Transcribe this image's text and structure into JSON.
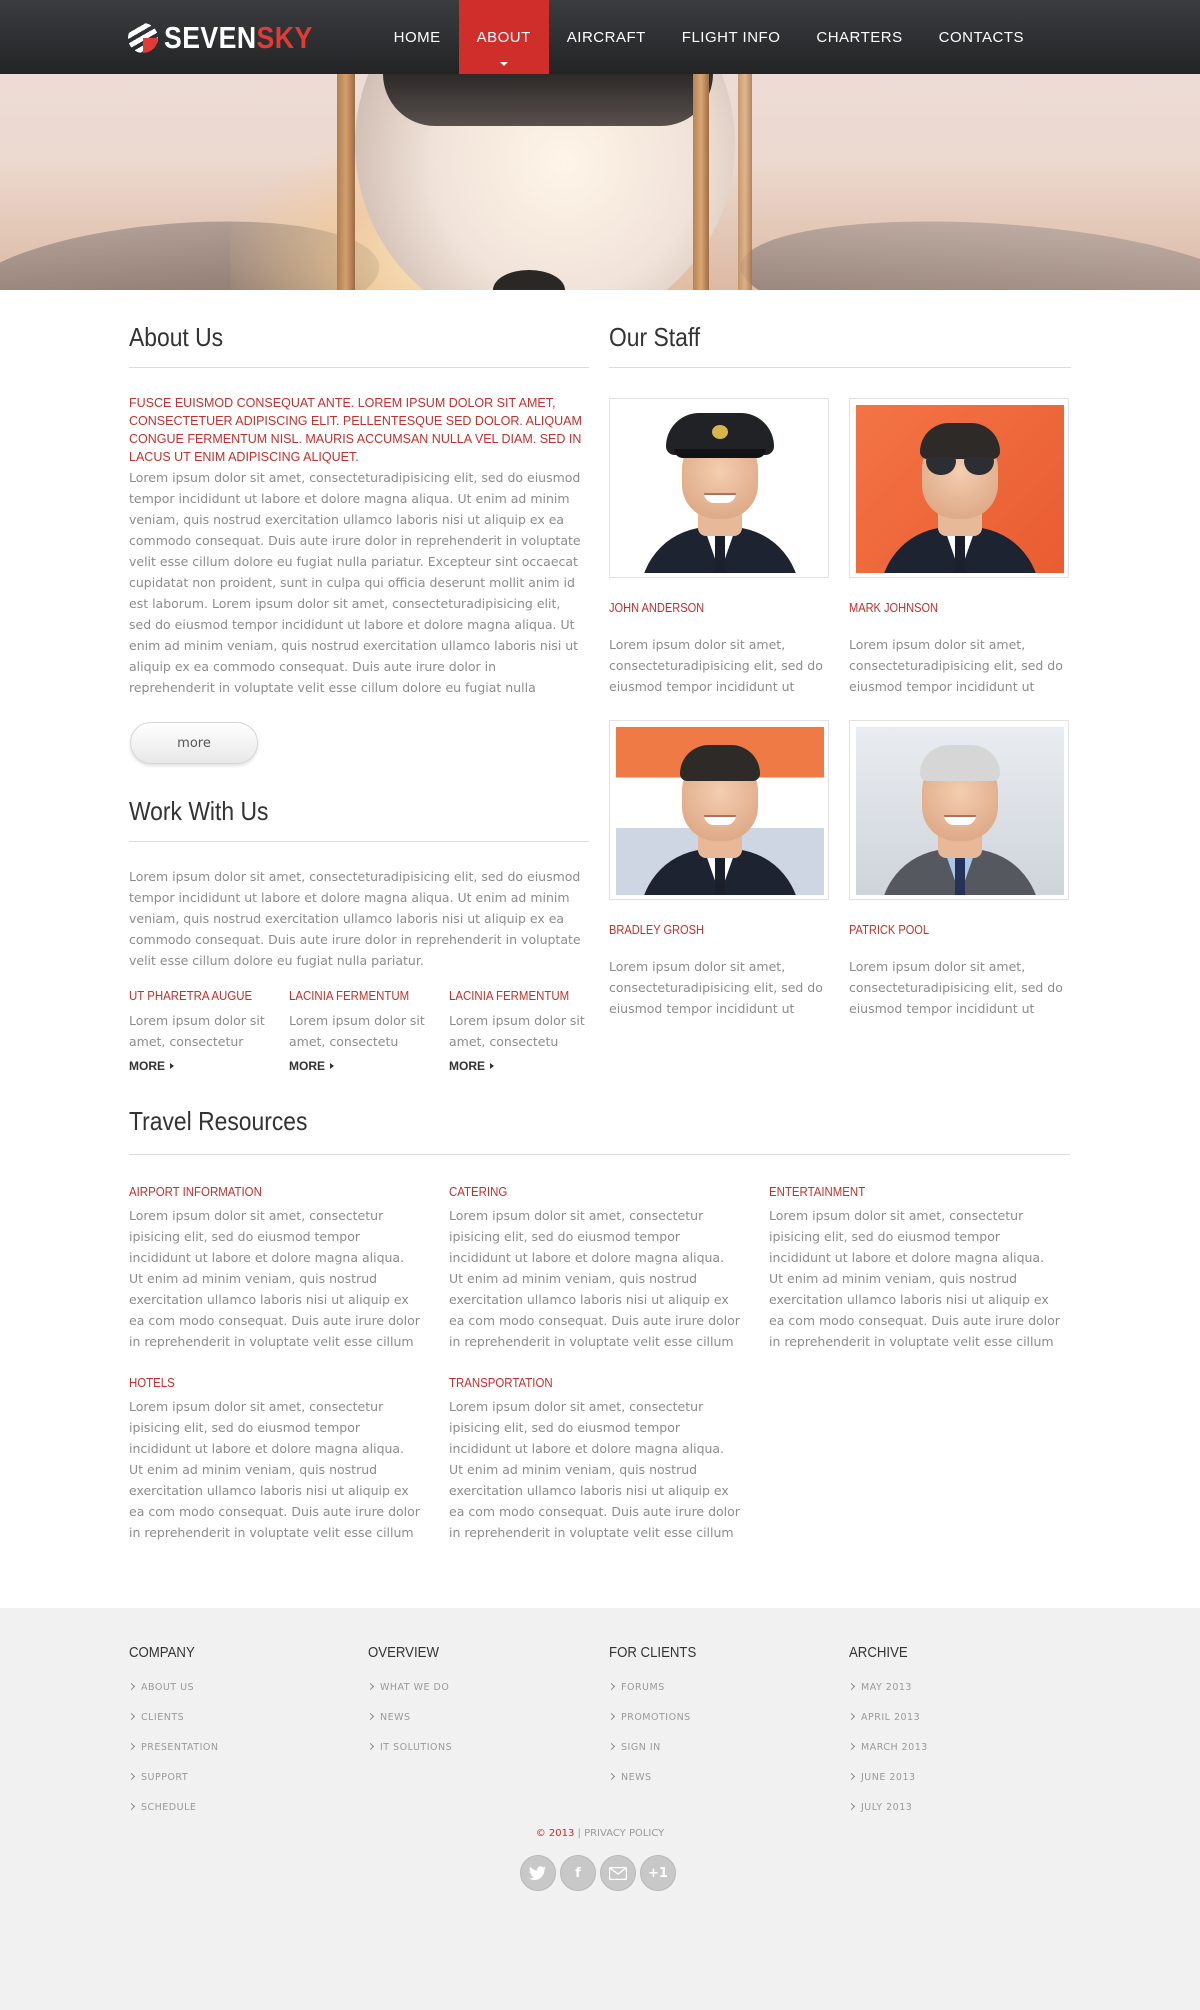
{
  "brand": {
    "name_first": "SEVEN",
    "name_second": "SKY"
  },
  "nav": [
    {
      "label": "HOME",
      "active": false
    },
    {
      "label": "ABOUT",
      "active": true
    },
    {
      "label": "AIRCRAFT",
      "active": false
    },
    {
      "label": "FLIGHT INFO",
      "active": false
    },
    {
      "label": "CHARTERS",
      "active": false
    },
    {
      "label": "CONTACTS",
      "active": false
    }
  ],
  "about": {
    "title": "About Us",
    "intro": "FUSCE EUISMOD CONSEQUAT ANTE. LOREM IPSUM DOLOR SIT AMET, CONSECTETUER ADIPISCING ELIT. PELLENTESQUE SED DOLOR. ALIQUAM CONGUE FERMENTUM NISL. MAURIS ACCUMSAN NULLA VEL DIAM. SED IN LACUS UT ENIM ADIPISCING ALIQUET.",
    "body": "Lorem ipsum dolor sit amet, consecteturadipisicing elit, sed do eiusmod tempor incididunt ut labore et dolore magna aliqua. Ut enim ad minim veniam, quis nostrud exercitation ullamco laboris nisi ut aliquip ex ea commodo consequat. Duis aute irure dolor in reprehenderit in voluptate velit esse cillum dolore eu fugiat nulla pariatur. Excepteur sint occaecat cupidatat non proident, sunt in culpa qui officia deserunt mollit anim id est laborum. Lorem ipsum dolor sit amet, consecteturadipisicing elit, sed do eiusmod tempor incididunt ut labore et dolore magna aliqua. Ut enim ad minim veniam, quis nostrud exercitation ullamco laboris nisi ut aliquip ex ea commodo consequat. Duis aute irure dolor in reprehenderit in voluptate velit esse cillum dolore eu fugiat nulla pariatur. Excepteur sint occaecat cupid-",
    "more_label": "more"
  },
  "work": {
    "title": "Work With Us",
    "body": "Lorem ipsum dolor sit amet, consecteturadipisicing elit, sed do eiusmod tempor incididunt ut labore et dolore magna aliqua. Ut enim ad minim veniam, quis nostrud exercitation ullamco laboris nisi ut aliquip ex ea commodo consequat. Duis aute irure dolor in reprehenderit in voluptate velit esse cillum dolore eu fugiat nulla pariatur.",
    "columns": [
      {
        "heading": "UT PHARETRA AUGUE",
        "text": "Lorem ipsum dolor sit amet, consectetur",
        "more": "MORE"
      },
      {
        "heading": "LACINIA FERMENTUM",
        "text": "Lorem ipsum dolor sit amet, consectetu",
        "more": "MORE"
      },
      {
        "heading": "LACINIA FERMENTUM",
        "text": "Lorem ipsum dolor sit amet, consectetu",
        "more": "MORE"
      }
    ]
  },
  "staff": {
    "title": "Our Staff",
    "members": [
      {
        "name": "JOHN ANDERSON",
        "text": "Lorem ipsum dolor sit amet, consecteturadipisicing elit, sed do eiusmod tempor incididunt ut labore et"
      },
      {
        "name": "MARK JOHNSON",
        "text": "Lorem ipsum dolor sit amet, consecteturadipisicing elit, sed do eiusmod tempor incididunt ut labore et"
      },
      {
        "name": "BRADLEY GROSH",
        "text": "Lorem ipsum dolor sit amet, consecteturadipisicing elit, sed do eiusmod tempor incididunt ut labore et"
      },
      {
        "name": "PATRICK POOL",
        "text": "Lorem ipsum dolor sit amet, consecteturadipisicing elit, sed do eiusmod tempor incididunt ut labore et"
      }
    ]
  },
  "travel": {
    "title": "Travel Resources",
    "items": [
      {
        "heading": "AIRPORT INFORMATION",
        "text": "Lorem ipsum dolor sit amet, consectetur ipisicing elit, sed do eiusmod tempor incididunt ut labore et dolore magna aliqua. Ut enim ad minim veniam, quis nostrud exercitation ullamco laboris nisi ut aliquip ex ea com modo consequat. Duis aute irure dolor in reprehenderit in voluptate velit esse cillum dolore eu fugiat"
      },
      {
        "heading": "CATERING",
        "text": "Lorem ipsum dolor sit amet, consectetur ipisicing elit, sed do eiusmod tempor incididunt ut labore et dolore magna aliqua. Ut enim ad minim veniam, quis nostrud exercitation ullamco laboris nisi ut aliquip ex ea com modo consequat. Duis aute irure dolor in reprehenderit in voluptate velit esse cillum dolore eu fugiat"
      },
      {
        "heading": "ENTERTAINMENT",
        "text": "Lorem ipsum dolor sit amet, consectetur ipisicing elit, sed do eiusmod tempor incididunt ut labore et dolore magna aliqua. Ut enim ad minim veniam, quis nostrud exercitation ullamco laboris nisi ut aliquip ex ea com modo consequat. Duis aute irure dolor in reprehenderit in voluptate velit esse cillum dolore eu fugiat"
      },
      {
        "heading": "HOTELS",
        "text": "Lorem ipsum dolor sit amet, consectetur ipisicing elit, sed do eiusmod tempor incididunt ut labore et dolore magna aliqua. Ut enim ad minim veniam, quis nostrud exercitation ullamco laboris nisi ut aliquip ex ea com modo consequat. Duis aute irure dolor in reprehenderit in voluptate velit esse cillum dolore eu fugiat"
      },
      {
        "heading": "TRANSPORTATION",
        "text": "Lorem ipsum dolor sit amet, consectetur ipisicing elit, sed do eiusmod tempor incididunt ut labore et dolore magna aliqua. Ut enim ad minim veniam, quis nostrud exercitation ullamco laboris nisi ut aliquip ex ea com modo consequat. Duis aute irure dolor in reprehenderit in voluptate velit esse cillum dolore eu fugiat"
      }
    ]
  },
  "footer": {
    "columns": [
      {
        "heading": "COMPANY",
        "items": [
          "ABOUT US",
          "CLIENTS",
          "PRESENTATION",
          "SUPPORT",
          "SCHEDULE"
        ]
      },
      {
        "heading": "OVERVIEW",
        "items": [
          "WHAT WE DO",
          "NEWS",
          "IT SOLUTIONS"
        ]
      },
      {
        "heading": "FOR CLIENTS",
        "items": [
          "FORUMS",
          "PROMOTIONS",
          "SIGN IN",
          "NEWS"
        ]
      },
      {
        "heading": "ARCHIVE",
        "items": [
          "MAY 2013",
          "APRIL 2013",
          "MARCH 2013",
          "JUNE 2013",
          "JULY 2013"
        ]
      }
    ],
    "copyright_year": "© 2013",
    "separator": " | ",
    "privacy": "PRIVACY POLICY",
    "socials": [
      {
        "icon": "twitter-icon",
        "glyph": ""
      },
      {
        "icon": "facebook-icon",
        "glyph": "f"
      },
      {
        "icon": "mail-icon",
        "glyph": ""
      },
      {
        "icon": "google-plus-icon",
        "glyph": "+1"
      }
    ]
  },
  "colors": {
    "accent": "#c4302b",
    "nav_active": "#d02e2a",
    "header_bg": "#2c2d30",
    "footer_bg": "#f1f1f1"
  }
}
